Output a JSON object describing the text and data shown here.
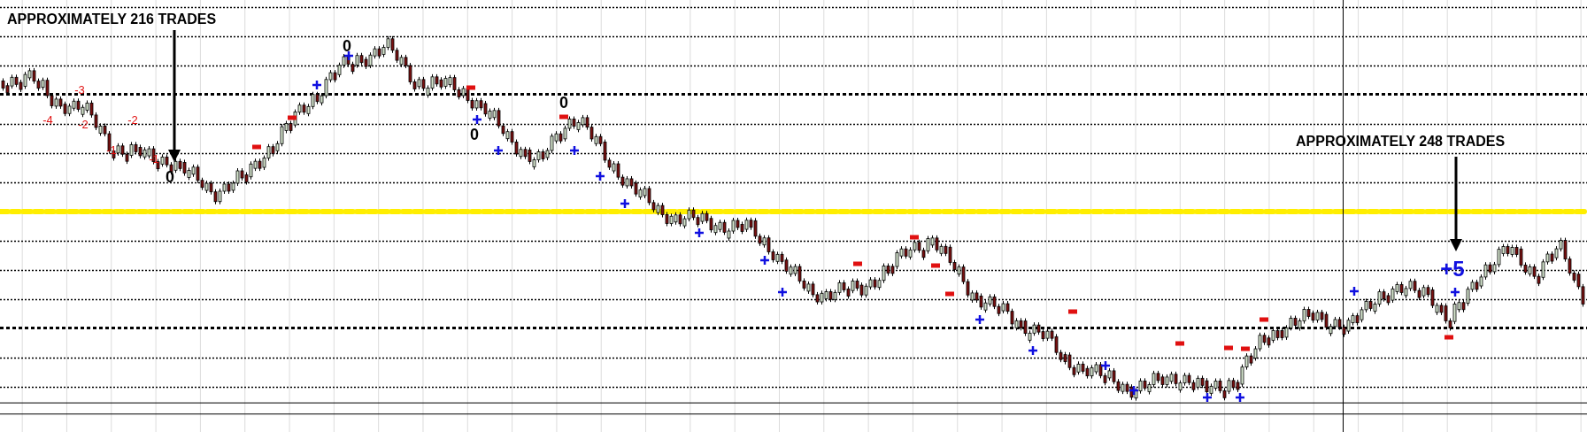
{
  "chart": {
    "annotations": [
      {
        "kind": "callout",
        "text": "APPROXIMATELY 216 TRADES"
      },
      {
        "kind": "callout",
        "text": "APPROXIMATELY 248 TRADES"
      },
      {
        "kind": "count",
        "text": "-3"
      },
      {
        "kind": "count",
        "text": "-4"
      },
      {
        "kind": "count",
        "text": "-2"
      },
      {
        "kind": "count",
        "text": "-2"
      },
      {
        "kind": "count",
        "text": "-1"
      },
      {
        "kind": "count",
        "text": "-1"
      },
      {
        "kind": "zero",
        "text": "0"
      },
      {
        "kind": "zero",
        "text": "0"
      },
      {
        "kind": "zero",
        "text": "0"
      },
      {
        "kind": "zero",
        "text": "0"
      },
      {
        "kind": "score",
        "text": "+5"
      }
    ]
  }
}
